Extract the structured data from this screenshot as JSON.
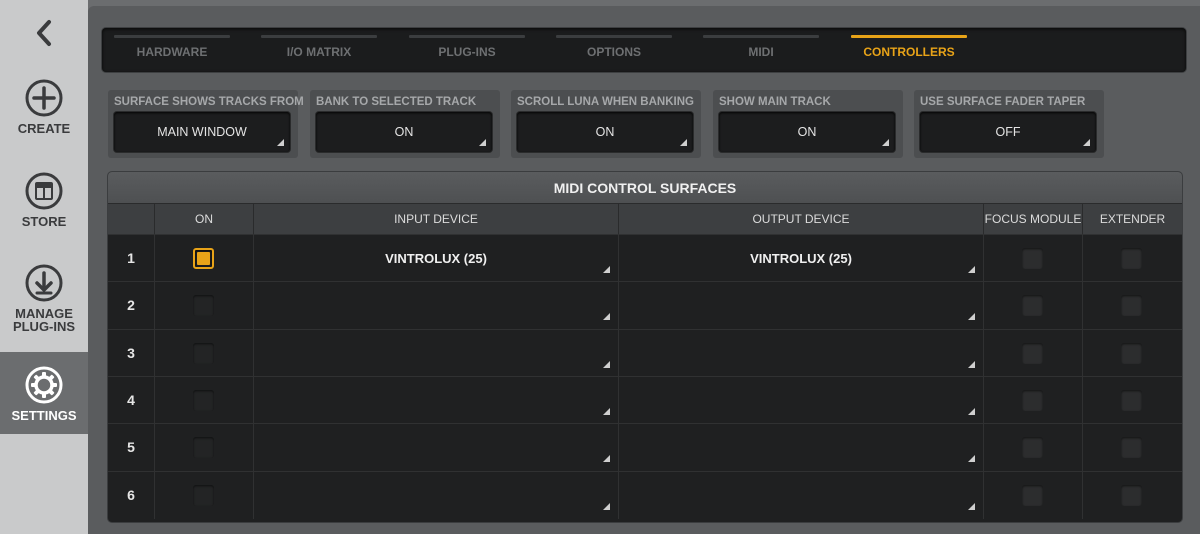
{
  "sidebar": {
    "items": [
      {
        "label": "CREATE",
        "icon": "plus-circle-icon"
      },
      {
        "label": "STORE",
        "icon": "store-icon"
      },
      {
        "label": "MANAGE PLUG-INS",
        "icon": "download-circle-icon"
      },
      {
        "label": "SETTINGS",
        "icon": "gear-icon",
        "active": true
      }
    ]
  },
  "tabs": [
    {
      "label": "HARDWARE"
    },
    {
      "label": "I/O MATRIX"
    },
    {
      "label": "PLUG-INS"
    },
    {
      "label": "OPTIONS"
    },
    {
      "label": "MIDI"
    },
    {
      "label": "CONTROLLERS",
      "active": true
    }
  ],
  "options": [
    {
      "label": "SURFACE SHOWS TRACKS FROM",
      "value": "MAIN WINDOW"
    },
    {
      "label": "BANK TO SELECTED TRACK",
      "value": "ON"
    },
    {
      "label": "SCROLL LUNA WHEN BANKING",
      "value": "ON"
    },
    {
      "label": "SHOW MAIN TRACK",
      "value": "ON"
    },
    {
      "label": "USE SURFACE FADER TAPER",
      "value": "OFF"
    }
  ],
  "table": {
    "title": "MIDI CONTROL SURFACES",
    "headers": {
      "on": "ON",
      "input": "INPUT DEVICE",
      "output": "OUTPUT DEVICE",
      "focus": "FOCUS MODULE",
      "extender": "EXTENDER"
    },
    "rows": [
      {
        "num": "1",
        "on": true,
        "input": "VINTROLUX (25)",
        "output": "VINTROLUX (25)",
        "focus": false,
        "extender": false
      },
      {
        "num": "2",
        "on": false,
        "input": "",
        "output": "",
        "focus": false,
        "extender": false
      },
      {
        "num": "3",
        "on": false,
        "input": "",
        "output": "",
        "focus": false,
        "extender": false
      },
      {
        "num": "4",
        "on": false,
        "input": "",
        "output": "",
        "focus": false,
        "extender": false
      },
      {
        "num": "5",
        "on": false,
        "input": "",
        "output": "",
        "focus": false,
        "extender": false
      },
      {
        "num": "6",
        "on": false,
        "input": "",
        "output": "",
        "focus": false,
        "extender": false
      }
    ]
  },
  "colors": {
    "accent": "#e8a318",
    "sidebar_bg": "#c9cacb",
    "main_bg": "#5a5c5e"
  }
}
